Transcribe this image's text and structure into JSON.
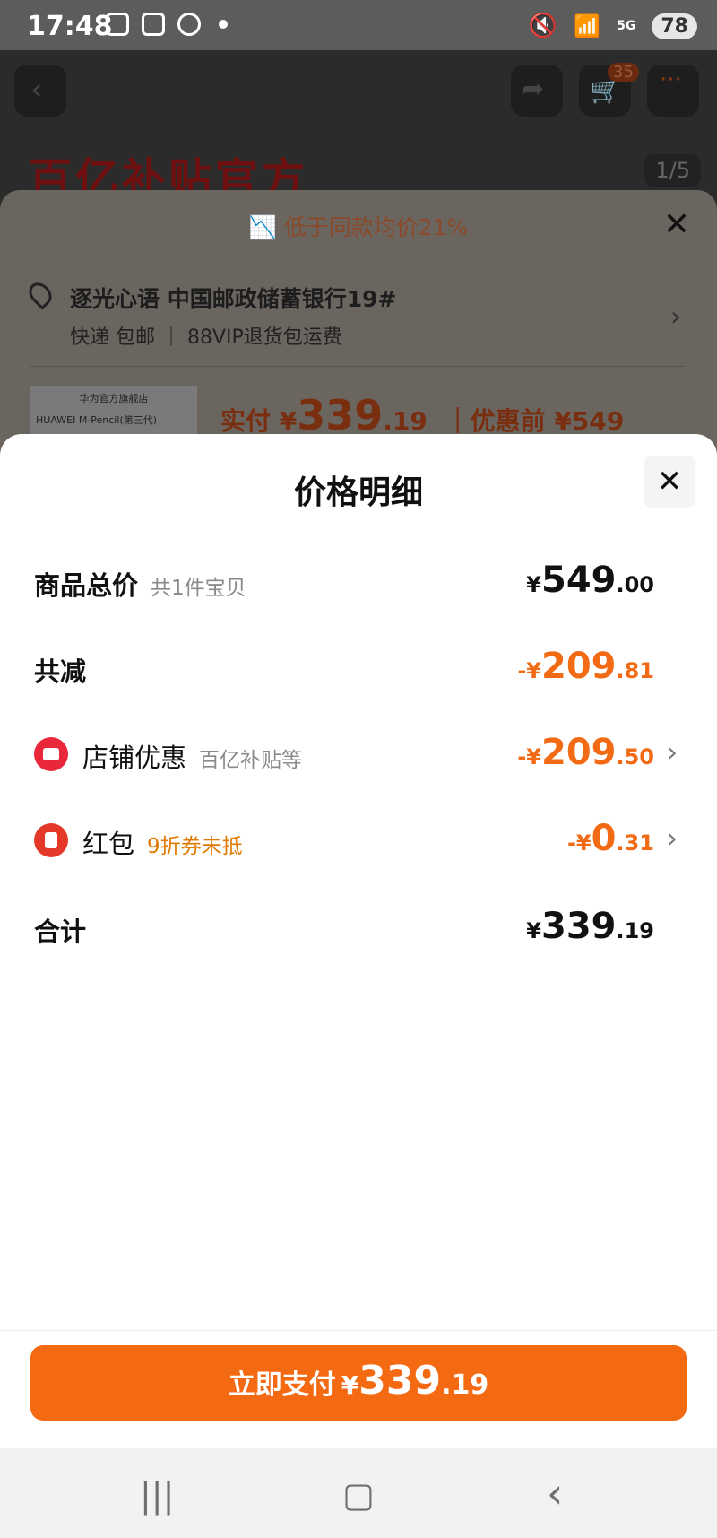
{
  "status_bar": {
    "time": "17:48",
    "battery": "78",
    "network": "5G"
  },
  "background": {
    "cart_badge": "35",
    "banner_text": "百亿补贴官方",
    "pager": "1/5",
    "hint": "低于同款均价21%",
    "address_line": "逐光心语 中国邮政储蓄银行19#",
    "shipping_line": "快递 包邮 ｜ 88VIP退货包运费",
    "thumb_store": "华为官方旗舰店",
    "thumb_product": "HUAWEI M-Pencil(第三代)",
    "price_prefix": "实付 ¥",
    "price_int": "339",
    "price_dec": ".19",
    "price_before": "｜优惠前 ¥549"
  },
  "sheet": {
    "title": "价格明细",
    "rows": [
      {
        "label": "商品总价",
        "sub": "共1件宝贝",
        "cur": "¥",
        "int": "549",
        "dec": ".00"
      },
      {
        "label": "共减",
        "sub": "",
        "cur": "-¥",
        "int": "209",
        "dec": ".81"
      },
      {
        "label": "店铺优惠",
        "sub": "百亿补贴等",
        "cur": "-¥",
        "int": "209",
        "dec": ".50"
      },
      {
        "label": "红包",
        "sub": "9折券未抵",
        "cur": "-¥",
        "int": "0",
        "dec": ".31"
      },
      {
        "label": "合计",
        "sub": "",
        "cur": "¥",
        "int": "339",
        "dec": ".19"
      }
    ]
  },
  "pay_button": {
    "label": "立即支付",
    "cur": "¥",
    "int": "339",
    "dec": ".19"
  },
  "colors": {
    "accent": "#f46a12",
    "discount": "#f26a14",
    "coupon_note": "#e07a00"
  }
}
